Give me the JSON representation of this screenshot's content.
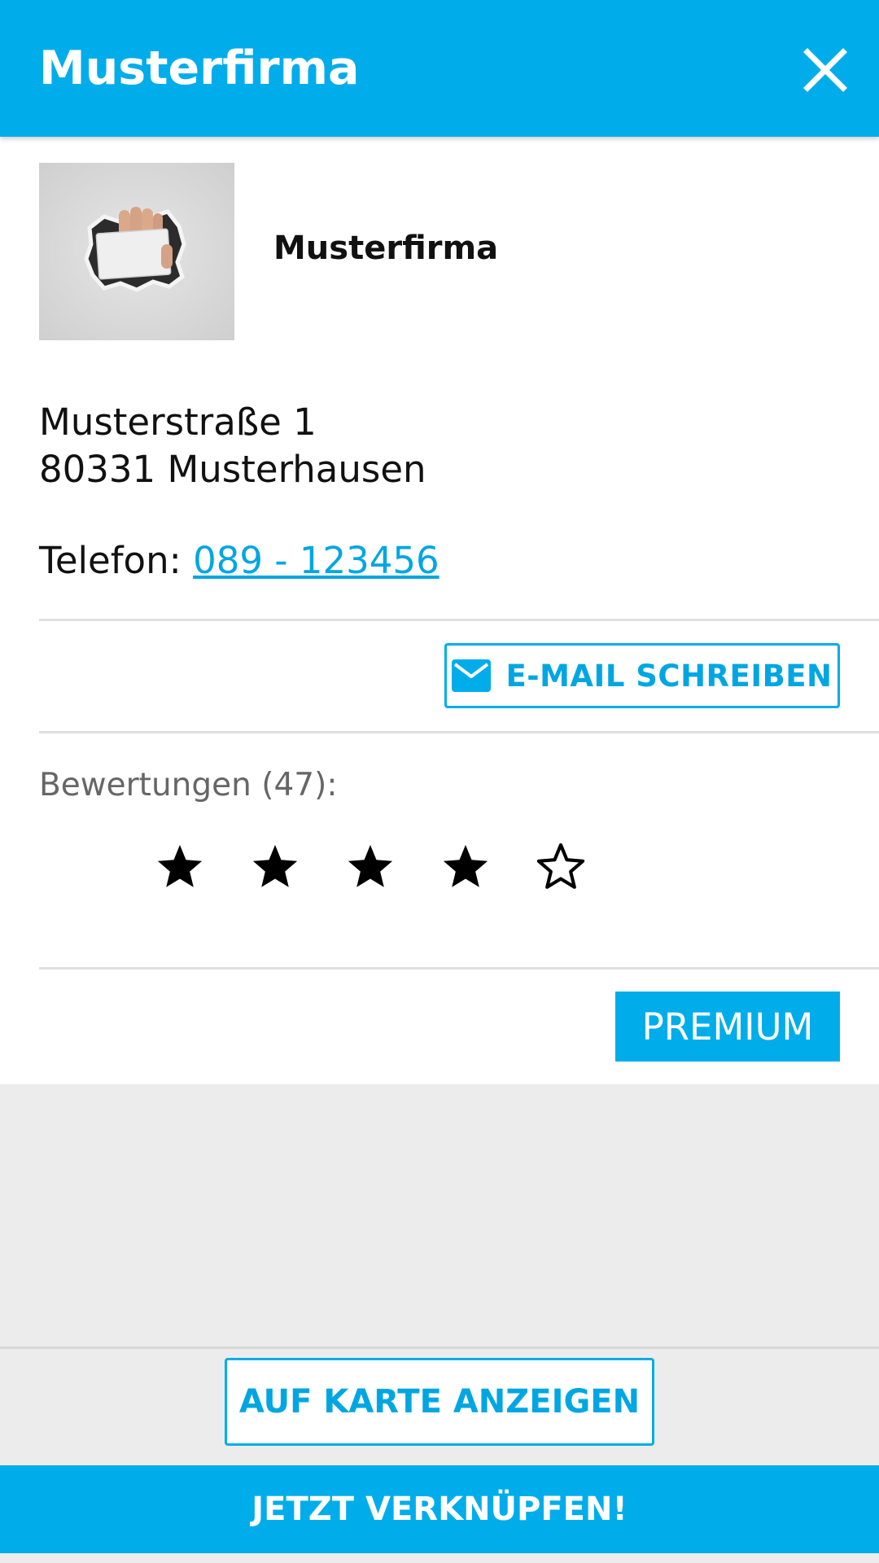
{
  "header": {
    "title": "Musterfirma",
    "close_icon": "close-icon"
  },
  "company": {
    "name": "Musterfirma",
    "image_description_icon": "hand-holding-card-image"
  },
  "address": {
    "street": "Musterstraße 1",
    "city": "80331 Musterhausen"
  },
  "phone": {
    "label": "Telefon: ",
    "number": "089 - 123456"
  },
  "email_button": {
    "label": "E-MAIL SCHREIBEN",
    "icon": "mail-icon"
  },
  "ratings": {
    "label": "Bewertungen (47):",
    "count": 47,
    "stars_filled": 4,
    "stars_total": 5
  },
  "premium_button": {
    "label": "PREMIUM"
  },
  "map_button": {
    "label": "AUF KARTE ANZEIGEN"
  },
  "connect_button": {
    "label": "JETZT VERKNÜPFEN!"
  },
  "colors": {
    "accent": "#00adea",
    "link": "#00a6e2",
    "background": "#ececec",
    "card": "#ffffff",
    "muted_text": "#666666"
  }
}
